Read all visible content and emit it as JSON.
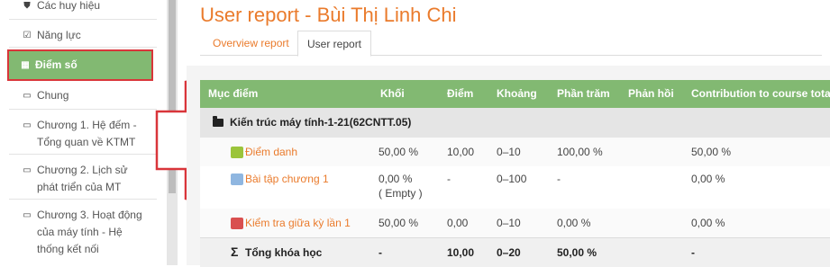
{
  "sidebar": {
    "items": [
      {
        "label": "Các huy hiệu",
        "icon": "shield-icon",
        "glyph": "⛊"
      },
      {
        "label": "Năng lực",
        "icon": "checkbox-icon",
        "glyph": "☑"
      },
      {
        "label": "Điểm số",
        "icon": "table-icon",
        "glyph": "▦",
        "active": true
      },
      {
        "label": "Chung",
        "icon": "folder-icon",
        "glyph": "▭"
      },
      {
        "label": "Chương 1. Hệ đếm - Tổng quan về KTMT",
        "icon": "folder-icon",
        "glyph": "▭"
      },
      {
        "label": "Chương 2. Lịch sử phát triển của MT",
        "icon": "folder-icon",
        "glyph": "▭"
      },
      {
        "label": "Chương 3. Hoạt động của máy tính - Hệ thống kết nối",
        "icon": "folder-icon",
        "glyph": "▭"
      }
    ]
  },
  "page": {
    "title": "User report - Bùi Thị Linh Chi",
    "tabs": [
      "Overview report",
      "User report"
    ],
    "active_tab": "User report"
  },
  "table": {
    "headers": [
      "Mục điểm",
      "Khối",
      "Điểm",
      "Khoảng",
      "Phần trăm",
      "Phản hồi",
      "Contribution to course total"
    ],
    "category": "Kiến trúc máy tính-1-21(62CNTT.05)",
    "rows": [
      {
        "name": "Điểm danh",
        "icon": "attendance-icon",
        "weight": "50,00 %",
        "weight2": "",
        "grade": "10,00",
        "range": "0–10",
        "percent": "100,00 %",
        "feedback": "",
        "contribution": "50,00 %"
      },
      {
        "name": "Bài tập chương 1",
        "icon": "assignment-icon",
        "weight": "0,00 %",
        "weight2": "( Empty )",
        "grade": "-",
        "range": "0–100",
        "percent": "-",
        "feedback": "",
        "contribution": "0,00 %"
      },
      {
        "name": "Kiểm tra giữa kỳ lần 1",
        "icon": "quiz-icon",
        "weight": "50,00 %",
        "weight2": "",
        "grade": "0,00",
        "range": "0–10",
        "percent": "0,00 %",
        "feedback": "",
        "contribution": "0,00 %"
      }
    ],
    "total": {
      "label": "Tổng khóa học",
      "weight": "-",
      "grade": "10,00",
      "range": "0–20",
      "percent": "50,00 %",
      "feedback": "",
      "contribution": "-"
    }
  },
  "colors": {
    "accent": "#ea7b2c",
    "header_green": "#82b972",
    "highlight_red": "#d9353a"
  }
}
